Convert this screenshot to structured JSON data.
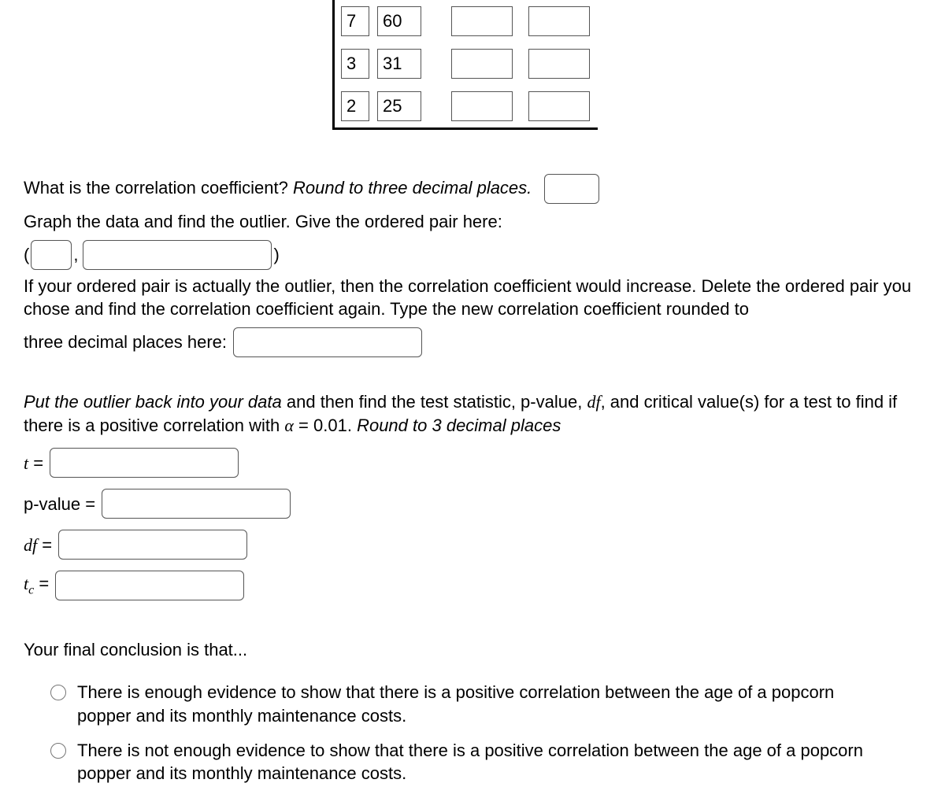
{
  "table": {
    "rows": [
      {
        "c1": "7",
        "c2": "60"
      },
      {
        "c1": "3",
        "c2": "31"
      },
      {
        "c1": "2",
        "c2": "25"
      }
    ]
  },
  "q1": {
    "prompt_a": "What is the correlation coefficient? ",
    "prompt_b": "Round to three decimal places."
  },
  "q2": {
    "prompt": "Graph the data and find the outlier. Give the ordered pair here:",
    "open": "(",
    "comma": ",",
    "close": ")"
  },
  "q3": {
    "text": "If your ordered pair is actually the outlier, then the correlation coefficient would increase. Delete the ordered pair you chose and find the correlation coefficient again. Type the new correlation coefficient rounded to",
    "text2": "three decimal places here:"
  },
  "q4": {
    "part1": "Put the outlier back into your data",
    "part2": " and then find the test statistic, p-value, ",
    "df": "df",
    "part3": ", and critical value(s) for a test to find if there is a positive correlation with ",
    "alpha": "α",
    "eq": " = ",
    "alpha_val": "0.01",
    "part4": ". ",
    "round": "Round to 3 decimal places"
  },
  "labels": {
    "t": "t",
    "eq": " = ",
    "pvalue": "p-value = ",
    "df": "df",
    "tc_t": "t",
    "tc_c": "c"
  },
  "conclusion": {
    "heading": "Your final conclusion is that...",
    "opt1": "There is enough evidence to show that there is a positive correlation between the age of a popcorn popper and its monthly maintenance costs.",
    "opt2": "There is not enough evidence to show that there is a positive correlation between the age of a popcorn popper and its monthly maintenance costs."
  }
}
